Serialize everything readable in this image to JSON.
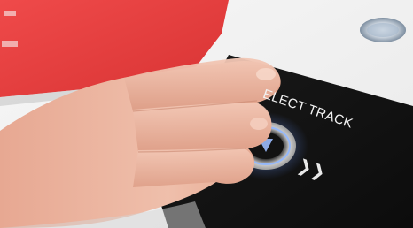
{
  "panel": {
    "label": "ELECT TRACK",
    "chevrons": "❯❯"
  },
  "icons": {
    "button": "arrow-down-icon"
  },
  "colors": {
    "red_card": "#e03b3b",
    "panel": "#131313",
    "button_glow": "#7aa6ff",
    "skin": "#e9b39f",
    "background": "#f4f4f4"
  }
}
